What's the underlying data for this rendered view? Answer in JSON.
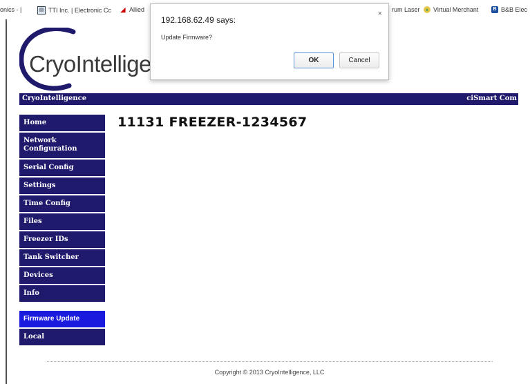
{
  "bookmarks": [
    {
      "label": "onics - |",
      "icon": "none"
    },
    {
      "label": "TTI Inc. | Electronic Cc",
      "icon": "tti-icon"
    },
    {
      "label": "Allied",
      "icon": "allied-icon"
    },
    {
      "label": "rum Laser",
      "icon": "none"
    },
    {
      "label": "Virtual Merchant",
      "icon": "virtual-merchant-icon"
    },
    {
      "label": "B&B Elec",
      "icon": "bb-icon"
    }
  ],
  "logo": {
    "text": "CryoIntelligen"
  },
  "header": {
    "left": "CryoIntelligence",
    "right": "ciSmart Com"
  },
  "nav": {
    "items": [
      {
        "label": "Home"
      },
      {
        "label": "Network Configuration"
      },
      {
        "label": "Serial Config"
      },
      {
        "label": "Settings"
      },
      {
        "label": "Time Config"
      },
      {
        "label": "Files"
      },
      {
        "label": "Freezer IDs"
      },
      {
        "label": "Tank Switcher"
      },
      {
        "label": "Devices"
      },
      {
        "label": "Info"
      }
    ],
    "secondary": [
      {
        "label": "Firmware Update",
        "active": true
      },
      {
        "label": "Local"
      }
    ]
  },
  "main": {
    "title": "11131 FREEZER-1234567"
  },
  "footer": {
    "copyright": "Copyright © 2013 CryoIntelligence, LLC"
  },
  "dialog": {
    "title": "192.168.62.49 says:",
    "message": "Update Firmware?",
    "ok_label": "OK",
    "cancel_label": "Cancel",
    "close_symbol": "×"
  },
  "colors": {
    "nav_bg": "#1f1a6b",
    "nav_active": "#1a1adf",
    "logo_arc": "#1f1a6b"
  }
}
